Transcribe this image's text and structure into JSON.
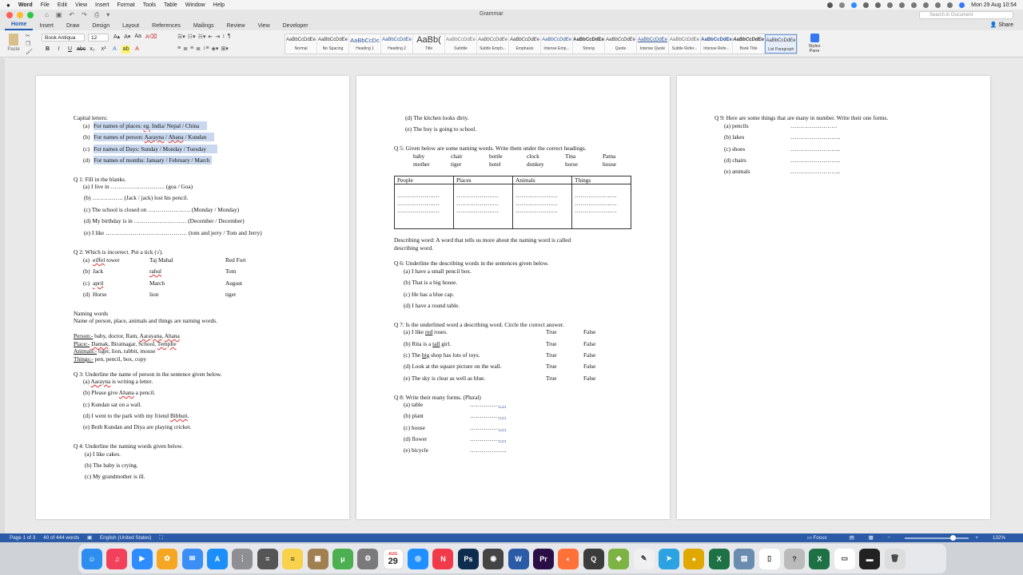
{
  "menubar": {
    "app_name": "Word",
    "items": [
      "File",
      "Edit",
      "View",
      "Insert",
      "Format",
      "Tools",
      "Table",
      "Window",
      "Help"
    ],
    "clock": "Mon 29 Aug  10:54"
  },
  "window": {
    "title": "Grammar",
    "search_placeholder": "Search in Document"
  },
  "ribbon": {
    "tabs": [
      "Home",
      "Insert",
      "Draw",
      "Design",
      "Layout",
      "References",
      "Mailings",
      "Review",
      "View",
      "Developer"
    ],
    "share_label": "Share",
    "paste_label": "Paste",
    "font_name": "Book Antiqua",
    "font_size": "12",
    "styles": [
      {
        "preview": "AaBbCcDdEe",
        "name": "Normal"
      },
      {
        "preview": "AaBbCcDdEe",
        "name": "No Spacing"
      },
      {
        "preview": "AaBbCcDc",
        "name": "Heading 1"
      },
      {
        "preview": "AaBbCcDdEe",
        "name": "Heading 2"
      },
      {
        "preview": "AaBb(",
        "name": "Title"
      },
      {
        "preview": "AaBbCcDdEe",
        "name": "Subtitle"
      },
      {
        "preview": "AaBbCcDdEe",
        "name": "Subtle Emph..."
      },
      {
        "preview": "AaBbCcDdEe",
        "name": "Emphasis"
      },
      {
        "preview": "AaBbCcDdEe",
        "name": "Intense Emp..."
      },
      {
        "preview": "AaBbCcDdEe",
        "name": "Strong"
      },
      {
        "preview": "AaBbCcDdEe",
        "name": "Quote"
      },
      {
        "preview": "AaBbCcDdEe",
        "name": "Intense Quote"
      },
      {
        "preview": "AaBbCcDdEe",
        "name": "Subtle Refer..."
      },
      {
        "preview": "AaBbCcDdEe",
        "name": "Intense Refe..."
      },
      {
        "preview": "AaBbCcDdEe",
        "name": "Book Title"
      },
      {
        "preview": "AaBbCcDdEe",
        "name": "List Paragraph"
      }
    ],
    "styles_pane_label": "Styles Pane"
  },
  "page1": {
    "capital_title": "Capital letters:",
    "cap_a_label": "(a)",
    "cap_a_text": "For names of places:",
    "cap_a_eg": "eg.",
    "cap_a_rest": "India/ Nepal / China",
    "cap_b_label": "(b)",
    "cap_b_text": "For names of person:",
    "cap_b_n1": "Aarayna",
    "cap_b_sep1": " / ",
    "cap_b_n2": "Ahana",
    "cap_b_rest": " / Kundan",
    "cap_c_label": "(c)",
    "cap_c_text": "For names of Days:  Sunday / Monday / Tuesday",
    "cap_d_label": "(d)",
    "cap_d_text": "For names of months: January / February / March",
    "q1_title": "Q 1: Fill in the blanks.",
    "q1_items": [
      {
        "label": "(a)",
        "text": "I live in ………………………. (goa / Goa)"
      },
      {
        "label": "(b)",
        "text": "……………. (Jack / jack) lost his pencil."
      },
      {
        "label": "(c)",
        "text": "The school is closed on …………………. (Monday / Monday)"
      },
      {
        "label": "(d)",
        "text": "My birthday is in ……………………… (December / December)"
      },
      {
        "label": "(e)",
        "text": "I like …………………………………… (tom and jerry / Tom and Jerry)"
      }
    ],
    "q2_title": "Q 2: Which is incorrect. Put a tick (√).",
    "q2_rows": [
      {
        "label": "(a)",
        "c1": "eiffel",
        "c1b": " tower",
        "c2": "Taj Mahal",
        "c3": "Red Fort"
      },
      {
        "label": "(b)",
        "c1": "Jack",
        "c1b": "",
        "c2": "rahul",
        "c3": "Tom"
      },
      {
        "label": "(c)",
        "c1": "april",
        "c1b": "",
        "c2": "March",
        "c3": "August"
      },
      {
        "label": "(d)",
        "c1": "Horse",
        "c1b": "",
        "c2": "lion",
        "c3": "tiger"
      }
    ],
    "naming_title": "Naming words",
    "naming_def": "Name of person, place, animals and things are naming words.",
    "person_label": "Person:-",
    "person_text": " baby, doctor, Ram, ",
    "person_n1": "Aarayana",
    "person_sep": ", ",
    "person_n2": "Ahana",
    "place_label": "Place:-",
    "place_sp": " ",
    "place_n1": "Damak",
    "place_text": ", Biratnagar, School, ",
    "place_n2": "Templte",
    "animals_label": "Animals:-",
    "animals_text": " tiger, lion, rabbit, mouse",
    "things_label": "Things:-",
    "things_text": " pen, pencil, box, copy",
    "q3_title": "Q 3: Underline the name of person in the sentence given below.",
    "q3_a_label": "(a)",
    "q3_a_name": "Aarayna",
    "q3_a_rest": " is writing a letter.",
    "q3_b_label": "(b)",
    "q3_b_pre": "Please give ",
    "q3_b_name": "Ahana",
    "q3_b_rest": " a pencil.",
    "q3_c_label": "(c)",
    "q3_c_text": "Kundan sat on a wall.",
    "q3_d_label": "(d)",
    "q3_d_pre": "I went to the park with my friend ",
    "q3_d_name": "Bibhuti",
    "q3_d_rest": ".",
    "q3_e_label": "(e)",
    "q3_e_text": "Both Kundan and Diya are playing cricket.",
    "q4_title": "Q 4: Underline the naming words given below.",
    "q4_items": [
      {
        "label": "(a)",
        "text": "I like cakes."
      },
      {
        "label": "(b)",
        "text": "The baby is crying."
      },
      {
        "label": "(c)",
        "text": "My grandmother is ill."
      }
    ]
  },
  "page2": {
    "q4_cont": [
      {
        "label": "(d)",
        "text": "The kitchen looks dirty."
      },
      {
        "label": "(e)",
        "text": "The boy is going to school."
      }
    ],
    "q5_title": "Q 5: Given below are some naming words. Write them under the correct headings.",
    "q5_words_row1": [
      "baby",
      "chair",
      "bottle",
      "clock",
      "Tina",
      "Patna"
    ],
    "q5_words_row2": [
      "mother",
      "tiger",
      "hotel",
      "donkey",
      "horse",
      "house"
    ],
    "table_headers": [
      "People",
      "Places",
      "Animals",
      "Things"
    ],
    "table_blank": "……………….…",
    "desc_line1": "Describing word: A word that tells us more about the naming word is called",
    "desc_line2": "describing word.",
    "q6_title": "Q 6: Underline the describing words in the sentences given below.",
    "q6_items": [
      {
        "label": "(a)",
        "text": "I have a small pencil box."
      },
      {
        "label": "(b)",
        "text": "That is a big house."
      },
      {
        "label": "(c)",
        "text": "He has a blue cap."
      },
      {
        "label": "(d)",
        "text": "I have a round table."
      }
    ],
    "q7_title": "Q 7: Is the underlined word a describing word. Circle the correct answer.",
    "q7_true": "True",
    "q7_false": "False",
    "q7_a_label": "(a)",
    "q7_a_pre": "I like ",
    "q7_a_word": "red",
    "q7_a_rest": " roses.",
    "q7_b_label": "(b)",
    "q7_b_pre": "Rita is a ",
    "q7_b_word": "tall",
    "q7_b_rest": " girl.",
    "q7_c_label": "(c)",
    "q7_c_pre": "The ",
    "q7_c_word": "big",
    "q7_c_rest": " shop has lots of toys.",
    "q7_d_label": "(d)",
    "q7_d_text": "Look at the square picture on the wall.",
    "q7_e_label": "(e)",
    "q7_e_text": "The sky is clear as well as blue.",
    "q8_title": "Q 8: Write their many forms. (Plural)",
    "q8_items": [
      {
        "label": "(a)",
        "text": "table",
        "blank": "……………",
        "tail": "…."
      },
      {
        "label": "(b)",
        "text": "plant",
        "blank": "……………",
        "tail": "…."
      },
      {
        "label": "(c)",
        "text": "house",
        "blank": "……………",
        "tail": "…."
      },
      {
        "label": "(d)",
        "text": "flower",
        "blank": "……………",
        "tail": "…."
      },
      {
        "label": "(e)",
        "text": "bicycle",
        "blank": "……………….",
        "tail": ""
      }
    ]
  },
  "page3": {
    "q9_title": "Q 9: Here are some things that are many in number. Write their one forms.",
    "q9_items": [
      {
        "label": "(a)",
        "text": "pencils",
        "blank": "……………………"
      },
      {
        "label": "(b)",
        "text": "lakes",
        "blank": "…………………….."
      },
      {
        "label": "(c)",
        "text": "shoes",
        "blank": "…………………….."
      },
      {
        "label": "(d)",
        "text": "chairs",
        "blank": "…………………….."
      },
      {
        "label": "(e)",
        "text": "animals",
        "blank": "…………………….."
      }
    ]
  },
  "statusbar": {
    "page": "Page 1 of 3",
    "words": "40 of 444 words",
    "language": "English (United States)",
    "focus": "Focus",
    "zoom": "132%",
    "zoom_fraction": 0.78
  },
  "dock": {
    "calendar_month": "AUG",
    "calendar_day": "29",
    "apps": [
      {
        "name": "finder",
        "color": "#2e8ef0",
        "glyph": "☺"
      },
      {
        "name": "music",
        "color": "#f2405a",
        "glyph": "♫"
      },
      {
        "name": "zoom",
        "color": "#2d8cff",
        "glyph": "▶"
      },
      {
        "name": "photos",
        "color": "#f5a623",
        "glyph": "✿"
      },
      {
        "name": "mail",
        "color": "#3a8ef6",
        "glyph": "✉"
      },
      {
        "name": "app-store",
        "color": "#1c8ef9",
        "glyph": "A"
      },
      {
        "name": "launchpad",
        "color": "#8e8e93",
        "glyph": "⋮"
      },
      {
        "name": "calculator",
        "color": "#555555",
        "glyph": "="
      },
      {
        "name": "notes",
        "color": "#f8d24a",
        "glyph": "≡"
      },
      {
        "name": "archive",
        "color": "#a08050",
        "glyph": "▣"
      },
      {
        "name": "torrent",
        "color": "#4caf50",
        "glyph": "μ"
      },
      {
        "name": "system-preferences",
        "color": "#7a7a7a",
        "glyph": "⚙"
      },
      {
        "name": "calendar",
        "color": "#ffffff",
        "glyph": ""
      },
      {
        "name": "safari",
        "color": "#1e90ff",
        "glyph": "◎"
      },
      {
        "name": "news",
        "color": "#f23b4a",
        "glyph": "N"
      },
      {
        "name": "photoshop",
        "color": "#0c2d4d",
        "glyph": "Ps"
      },
      {
        "name": "camera",
        "color": "#444444",
        "glyph": "◉"
      },
      {
        "name": "word",
        "color": "#2b5ba7",
        "glyph": "W"
      },
      {
        "name": "premiere",
        "color": "#2a0f47",
        "glyph": "Pr"
      },
      {
        "name": "firefox",
        "color": "#ff7139",
        "glyph": "◐"
      },
      {
        "name": "quicktime",
        "color": "#3b3b3b",
        "glyph": "Q"
      },
      {
        "name": "android",
        "color": "#7cb342",
        "glyph": "◆"
      },
      {
        "name": "textedit",
        "color": "#f0f0f0",
        "glyph": "✎"
      },
      {
        "name": "telegram",
        "color": "#2aa3e0",
        "glyph": "➤"
      },
      {
        "name": "chrome",
        "color": "#e0a800",
        "glyph": "●"
      },
      {
        "name": "excel",
        "color": "#1e7145",
        "glyph": "X"
      },
      {
        "name": "preview",
        "color": "#6a8caf",
        "glyph": "▤"
      },
      {
        "name": "document",
        "color": "#ffffff",
        "glyph": "▯"
      },
      {
        "name": "help",
        "color": "#bbbbbb",
        "glyph": "?"
      },
      {
        "name": "excel-doc",
        "color": "#1e7145",
        "glyph": "X"
      },
      {
        "name": "doc-thumb",
        "color": "#ffffff",
        "glyph": "▭"
      },
      {
        "name": "window-thumb",
        "color": "#222222",
        "glyph": "▬"
      },
      {
        "name": "trash",
        "color": "#dddddd",
        "glyph": "🗑"
      }
    ]
  }
}
